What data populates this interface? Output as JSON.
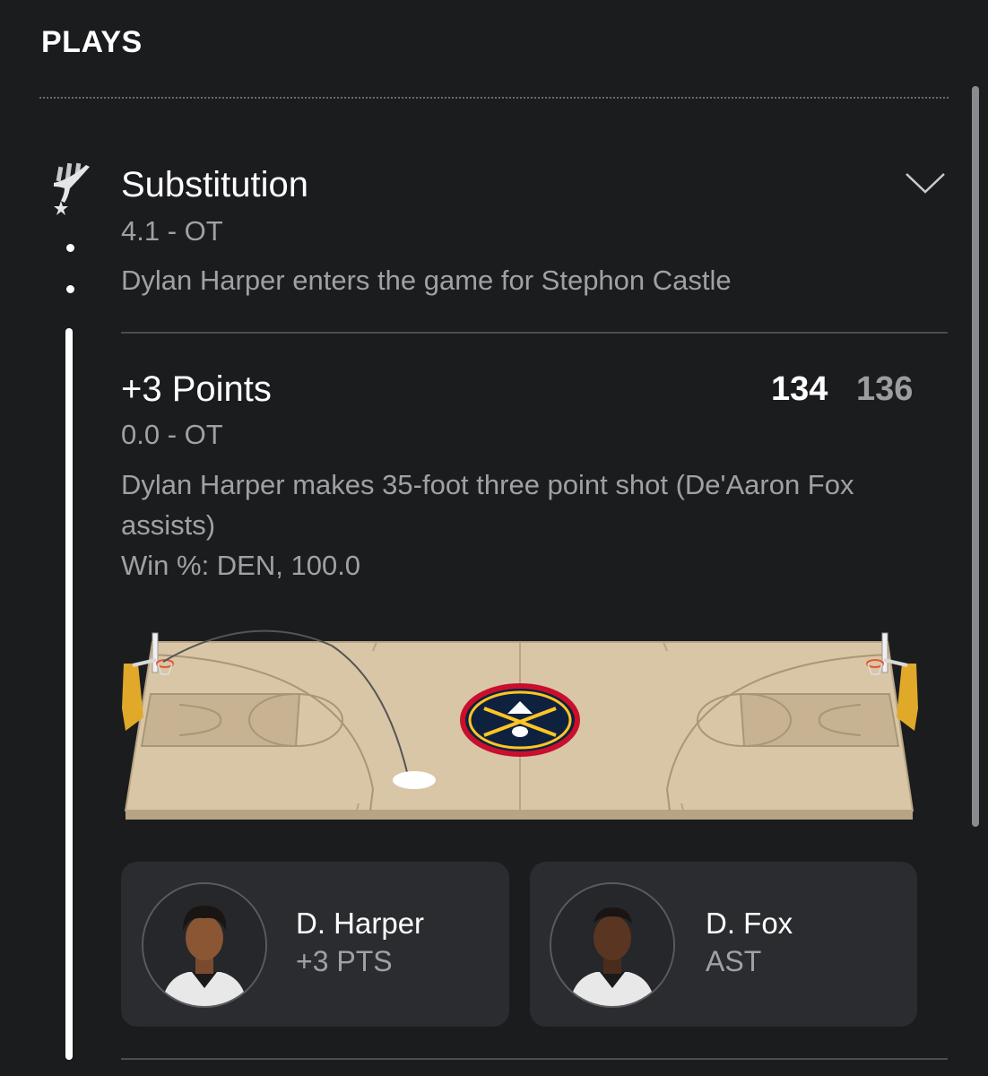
{
  "section": {
    "title": "PLAYS"
  },
  "plays": [
    {
      "title": "Substitution",
      "time": "4.1 - OT",
      "description": "Dylan Harper enters the game for Stephon Castle",
      "team_icon": "spurs-logo-icon",
      "expand_icon": "chevron-down-icon"
    },
    {
      "title": "+3 Points",
      "time": "0.0 - OT",
      "description": "Dylan Harper makes 35-foot three point shot (De'Aaron Fox assists)",
      "win_prob": "Win %: DEN, 100.0",
      "score_away": "134",
      "score_home": "136",
      "court": {
        "center_logo": "nuggets-logo-icon",
        "shot_result": "made"
      },
      "players": [
        {
          "name": "D. Harper",
          "stat": "+3 PTS"
        },
        {
          "name": "D. Fox",
          "stat": "AST"
        }
      ]
    }
  ],
  "colors": {
    "background": "#1b1c1e",
    "court": "#d9c6a6",
    "card": "#2b2c2f",
    "muted_text": "#a0a1a4"
  }
}
